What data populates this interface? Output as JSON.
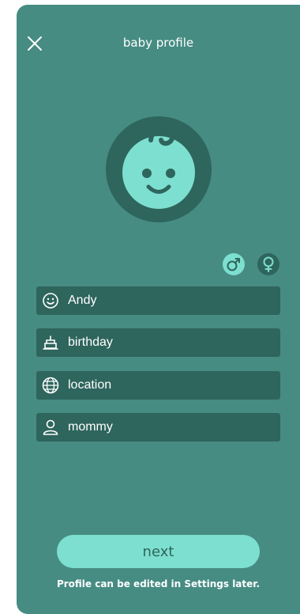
{
  "header": {
    "title": "baby profile",
    "close_icon": "close-icon"
  },
  "avatar": {
    "icon": "baby-face-icon"
  },
  "gender": {
    "options": [
      {
        "icon": "male-symbol-icon",
        "selected": true
      },
      {
        "icon": "female-symbol-icon",
        "selected": false
      }
    ]
  },
  "form": {
    "fields": [
      {
        "icon": "smiley-icon",
        "value": "Andy"
      },
      {
        "icon": "cake-icon",
        "value": "birthday"
      },
      {
        "icon": "globe-icon",
        "value": "location"
      },
      {
        "icon": "person-icon",
        "value": "mommy"
      }
    ]
  },
  "footer": {
    "next_label": "next",
    "hint": "Profile can be edited in Settings later."
  },
  "colors": {
    "background": "#468c83",
    "dark": "#2e655d",
    "accent": "#7ddfcf",
    "text": "#ffffff"
  }
}
